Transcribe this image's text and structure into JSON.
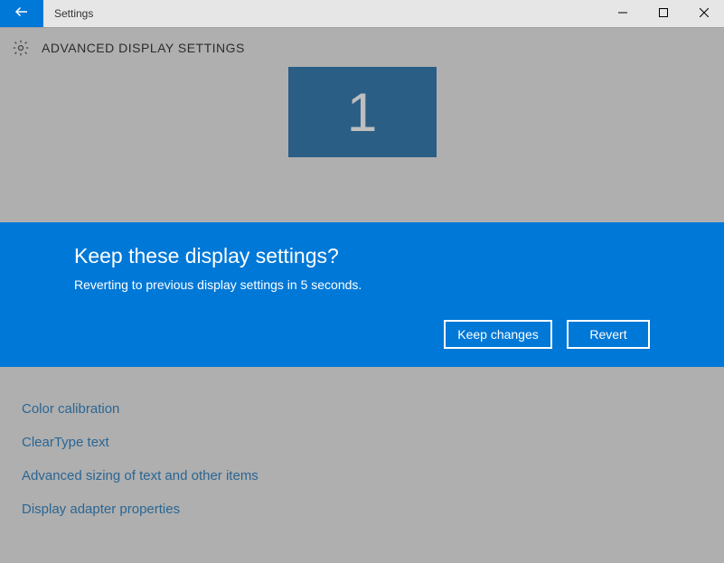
{
  "titlebar": {
    "title": "Settings"
  },
  "header": {
    "title": "ADVANCED DISPLAY SETTINGS"
  },
  "monitor": {
    "number": "1"
  },
  "dialog": {
    "title": "Keep these display settings?",
    "message": "Reverting to previous display settings in  5 seconds.",
    "keep_label": "Keep changes",
    "revert_label": "Revert"
  },
  "links": {
    "color_calibration": "Color calibration",
    "cleartype": "ClearType text",
    "advanced_sizing": "Advanced sizing of text and other items",
    "adapter_props": "Display adapter properties"
  }
}
